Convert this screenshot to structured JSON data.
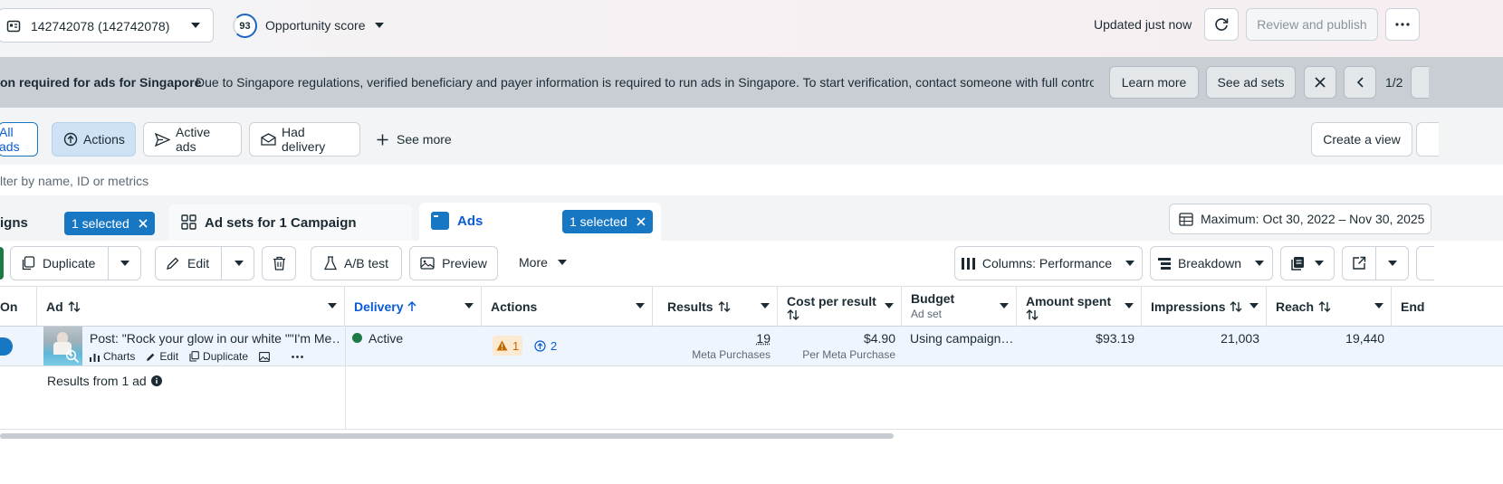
{
  "topbar": {
    "account": "142742078 (142742078)",
    "score_value": "93",
    "score_label": "Opportunity score",
    "updated": "Updated just now",
    "review_publish": "Review and publish"
  },
  "banner": {
    "title": "on required for ads for Singapore",
    "message": "Due to Singapore regulations, verified beneficiary and payer information is required to run ads in Singapore. To start verification, contact someone with full control …",
    "learn_more": "Learn more",
    "see_ad_sets": "See ad sets",
    "pager": "1/2"
  },
  "views": {
    "all_ads": "All ads",
    "actions": "Actions",
    "active_ads": "Active ads",
    "had_delivery": "Had delivery",
    "see_more": "See more",
    "create_view": "Create a view"
  },
  "filter": {
    "placeholder": "lter by name, ID or metrics"
  },
  "tabs": {
    "campaigns": "igns",
    "campaigns_selected": "1 selected",
    "adsets": "Ad sets for 1 Campaign",
    "ads": "Ads",
    "ads_selected": "1 selected",
    "date_range": "Maximum: Oct 30, 2022 – Nov 30, 2025"
  },
  "toolbar": {
    "duplicate": "Duplicate",
    "edit": "Edit",
    "ab_test": "A/B test",
    "preview": "Preview",
    "more": "More",
    "columns": "Columns: Performance",
    "breakdown": "Breakdown"
  },
  "table": {
    "headers": {
      "onoff": "On",
      "ad": "Ad",
      "delivery": "Delivery",
      "actions": "Actions",
      "results": "Results",
      "cpr": "Cost per result",
      "budget": "Budget",
      "budget_sub": "Ad set",
      "spent": "Amount spent",
      "impressions": "Impressions",
      "reach": "Reach",
      "ends": "End"
    },
    "row": {
      "ad_name": "Post: \"Rock your glow in our white \"\"I'm Me…",
      "charts": "Charts",
      "edit": "Edit",
      "duplicate": "Duplicate",
      "delivery": "Active",
      "warnings": "1",
      "actions_count": "2",
      "results": "19",
      "results_sub": "Meta Purchases",
      "cpr": "$4.90",
      "cpr_sub": "Per Meta Purchase",
      "budget": "Using campaign…",
      "spent": "$93.19",
      "impressions": "21,003",
      "reach": "19,440"
    },
    "footer": "Results from 1 ad"
  },
  "colors": {
    "accent": "#1877c2",
    "link": "#0a5bd6",
    "active_dot": "#1e7a45",
    "warning": "#c46a00"
  }
}
